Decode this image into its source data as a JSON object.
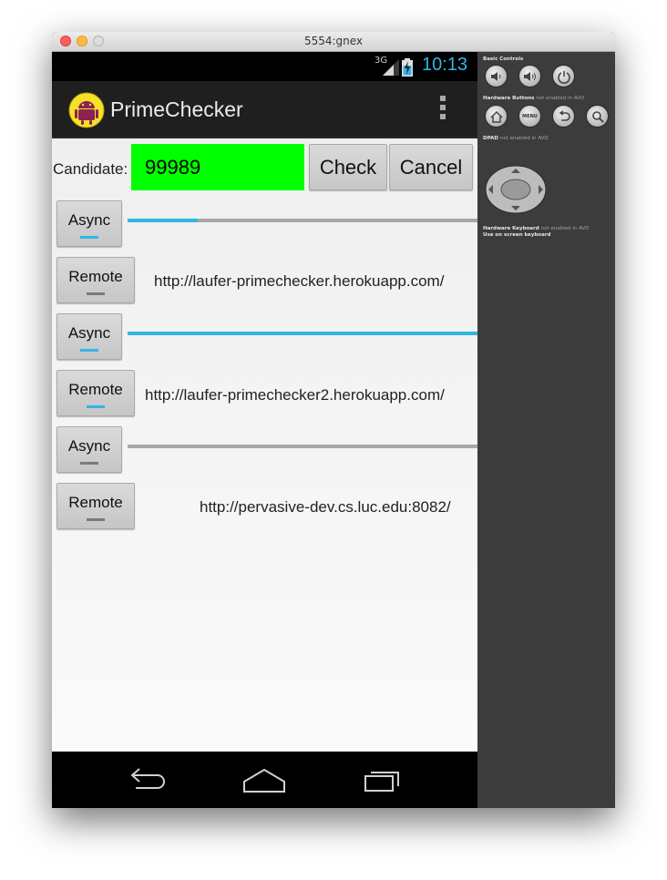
{
  "window": {
    "title": "5554:gnex"
  },
  "status_bar": {
    "network": "3G",
    "time": "10:13",
    "accent": "#33b5e5"
  },
  "app": {
    "title": "PrimeChecker",
    "icon": "android-icon"
  },
  "candidate": {
    "label": "Candidate:",
    "value": "99989",
    "background": "#00ff00"
  },
  "buttons": {
    "check": "Check",
    "cancel": "Cancel"
  },
  "rows": [
    {
      "button": "Async",
      "indicator_active": true,
      "progress": 0.2
    },
    {
      "button": "Remote",
      "indicator_active": false,
      "url": "http://laufer-primechecker.herokuapp.com/"
    },
    {
      "button": "Async",
      "indicator_active": true,
      "progress": 1.0
    },
    {
      "button": "Remote",
      "indicator_active": true,
      "url": "http://laufer-primechecker2.herokuapp.com/"
    },
    {
      "button": "Async",
      "indicator_active": false,
      "progress": 0.0
    },
    {
      "button": "Remote",
      "indicator_active": false,
      "url": "http://pervasive-dev.cs.luc.edu:8082/"
    }
  ],
  "nav_bar": {
    "icons": [
      "back-icon",
      "home-icon",
      "recent-apps-icon"
    ]
  },
  "controls_panel": {
    "basic_controls": "Basic Controls",
    "hardware_buttons": "Hardware Buttons",
    "hardware_buttons_note": "not enabled in AVD",
    "dpad": "DPAD",
    "dpad_note": "not enabled in AVD",
    "hardware_keyboard": "Hardware Keyboard",
    "hardware_keyboard_note": "not enabled in AVD",
    "keyboard_note": "Use on screen keyboard",
    "menu_label": "MENU"
  }
}
